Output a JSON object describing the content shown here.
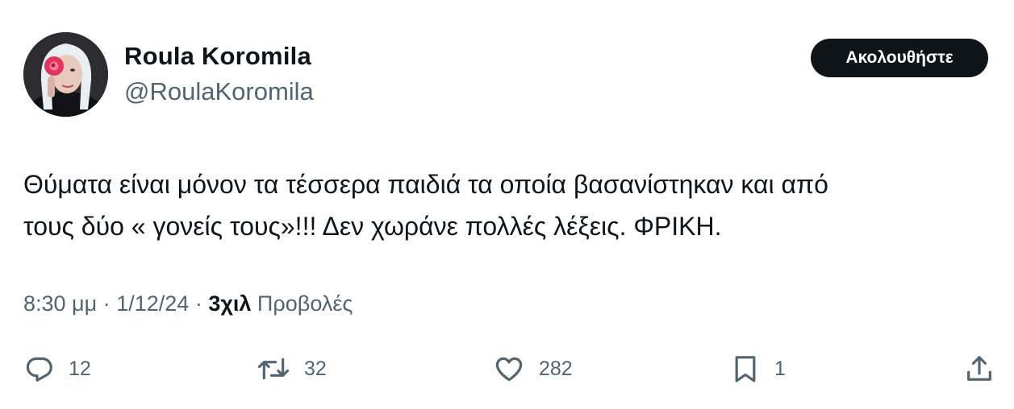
{
  "tweet": {
    "author": {
      "display_name": "Roula Koromila",
      "handle": "@RoulaKoromila"
    },
    "follow_label": "Ακολουθήστε",
    "text_lines": [
      "Θύματα είναι μόνον τα τέσσερα παιδιά  τα οποία βασανίστηκαν και από",
      "τους δύο « γονείς τους»!!! Δεν χωράνε πολλές λέξεις. ΦΡΙΚΗ."
    ],
    "time": "8:30 μμ",
    "separator": "·",
    "date": "1/12/24",
    "views_count": "3χιλ",
    "views_label": "Προβολές",
    "actions": {
      "replies": "12",
      "reposts": "32",
      "likes": "282",
      "bookmarks": "1"
    }
  },
  "icons": {
    "reply": "speech-bubble-icon",
    "repost": "repost-arrows-icon",
    "like": "heart-icon",
    "bookmark": "bookmark-icon",
    "share": "share-upload-icon"
  },
  "colors": {
    "text": "#0f1419",
    "secondary": "#536471",
    "button_bg": "#0f1419",
    "button_text": "#ffffff"
  }
}
